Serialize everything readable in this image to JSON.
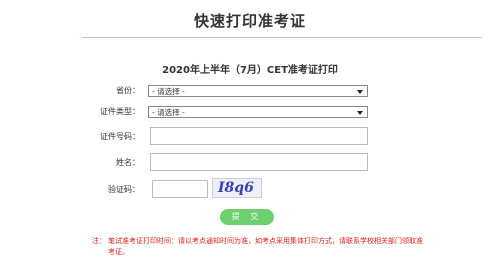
{
  "page": {
    "title": "快速打印准考证",
    "form_heading": "2020年上半年（7月）CET准考证打印"
  },
  "form": {
    "province": {
      "label": "省份：",
      "value": "- 请选择 -"
    },
    "id_type": {
      "label": "证件类型：",
      "value": "- 请选择 -"
    },
    "id_number": {
      "label": "证件号码：",
      "value": ""
    },
    "name": {
      "label": "姓名：",
      "value": ""
    },
    "captcha": {
      "label": "验证码：",
      "value": "",
      "image_text": "I8q6"
    },
    "submit_label": "提 交"
  },
  "note": {
    "prefix": "注：",
    "text": "笔试准考证打印时间：请以考点通知时间为准，如考点采用集体打印方式，请联系学校相关部门领取准考证。"
  },
  "colors": {
    "submit_button": "#6fcf6f",
    "note_text": "#e2211c",
    "title_rule": "#d4b8cf"
  }
}
